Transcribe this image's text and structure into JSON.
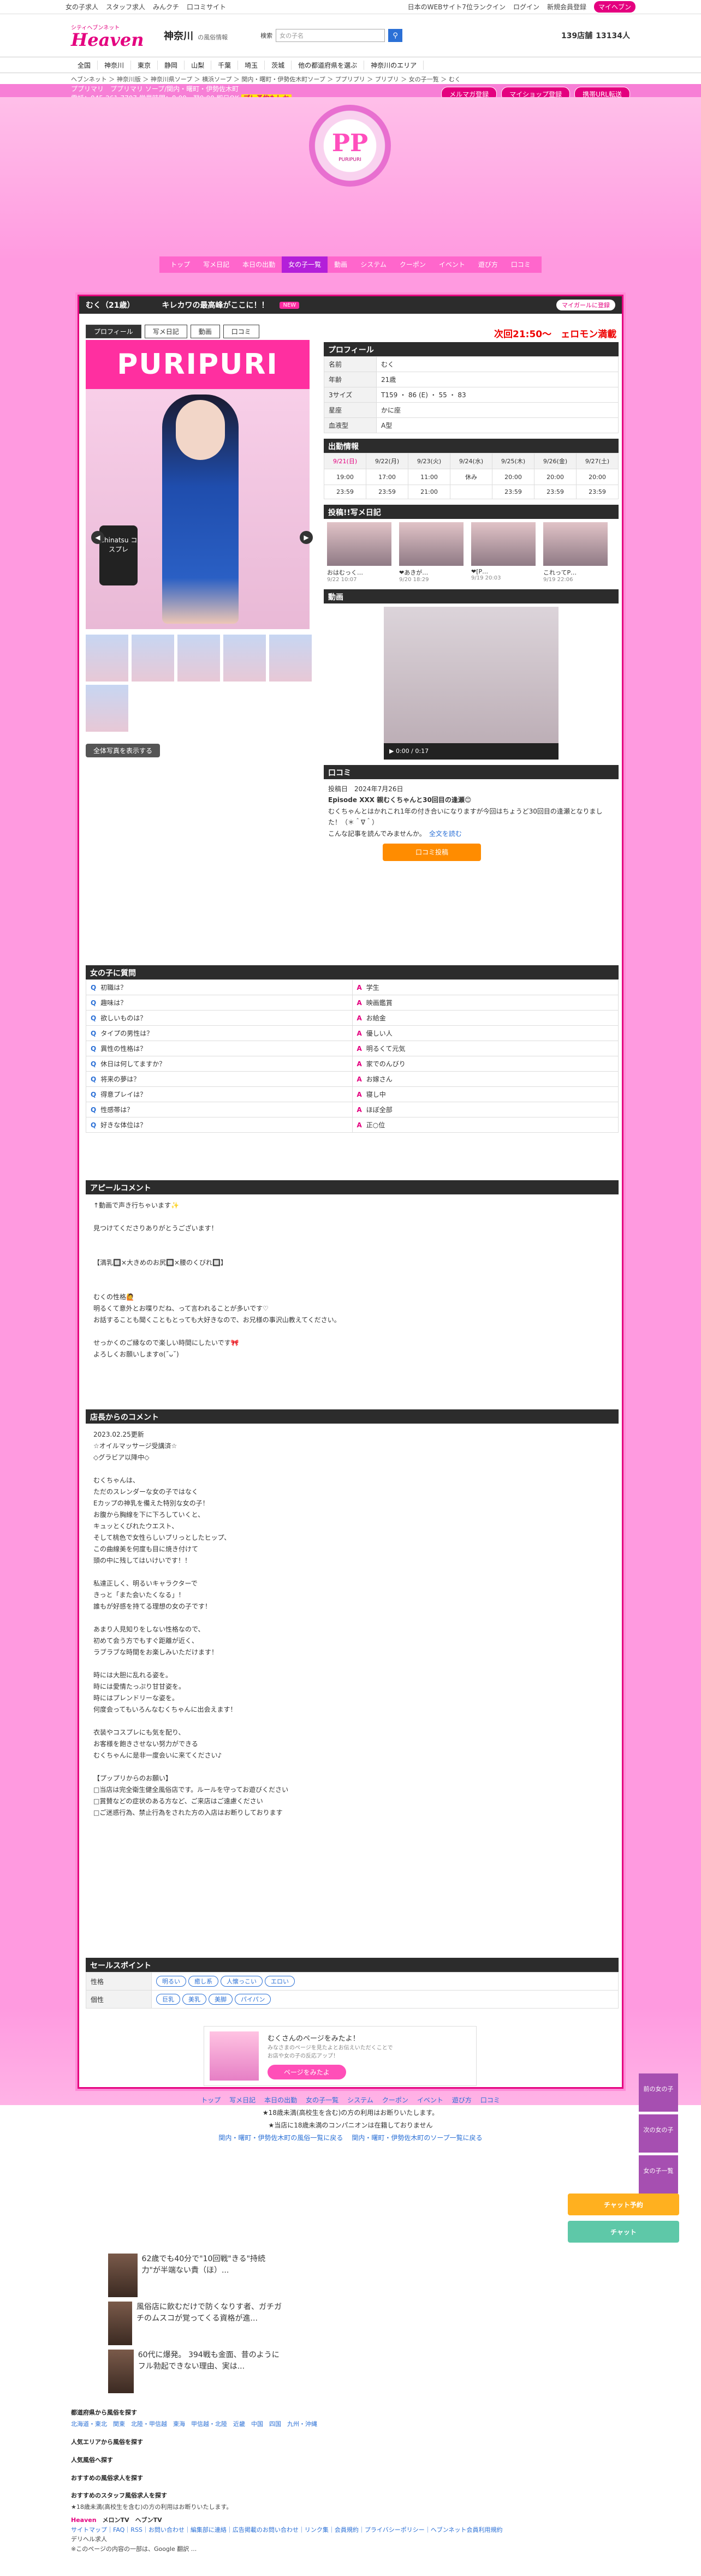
{
  "topbar": {
    "items": [
      "女の子求人",
      "スタッフ求人",
      "みんクチ",
      "口コミサイト"
    ],
    "right": [
      "日本のWEBサイト7位ランクイン",
      "ログイン",
      "新規会員登録",
      "マイヘブン"
    ]
  },
  "header": {
    "brand": "Heaven",
    "brand_sub": "シティヘブンネット",
    "area": "神奈川",
    "area_sub": "の風俗情報",
    "search_label": "検索",
    "search_placeholder": "女の子名",
    "count1": "139店舗",
    "count2": "13134人"
  },
  "nav": [
    "全国",
    "神奈川",
    "東京",
    "静岡",
    "山梨",
    "千葉",
    "埼玉",
    "茨城",
    "他の都道府県を選ぶ",
    "神奈川のエリア"
  ],
  "breadcrumb": "ヘブンネット ＞ 神奈川版 ＞ 神奈川県ソープ ＞ 横浜ソープ ＞ 関内・曙町・伊勢佐木町ソープ ＞ ププリプリ ＞ プリプリ ＞ 女の子一覧 ＞ むく",
  "pinkband": {
    "line1": "ププリマリ　ププリマリ ソープ/関内・曙町・伊勢佐木町",
    "line2": "電話：045-261-7707 営業時間：8:00～翌0:00 即日OK",
    "highlight": "プレ予約もしか",
    "buttons": [
      "メルマガ登録",
      "マイショップ登録",
      "携帯URL転送"
    ]
  },
  "shop": {
    "logo": "PP",
    "logo_caption": "PURIPURI"
  },
  "shopnav": [
    "トップ",
    "写メ日記",
    "本日の出勤",
    "女の子一覧",
    "動画",
    "システム",
    "クーポン",
    "イベント",
    "遊び方",
    "口コミ"
  ],
  "girl": {
    "name": "むく（21歳）",
    "catch": "キレカワの最高峰がここに！！",
    "badge": "NEW",
    "fav": "マイガールに登録",
    "tabs": [
      "プロフィール",
      "写メ日記",
      "動画",
      "口コミ"
    ],
    "marquee": "次回21:50～　ェロモン満載　絶対",
    "brand_banner": "PURIPURI",
    "photo_badge": "Chinatsu コスプレ",
    "all_btn": "全体写真を表示する"
  },
  "profile": {
    "title": "プロフィール",
    "rows": [
      {
        "k": "名前",
        "v": "むく"
      },
      {
        "k": "年齢",
        "v": "21歳"
      },
      {
        "k": "3サイズ",
        "v": "T159 ・ 86 (E) ・ 55 ・ 83"
      },
      {
        "k": "星座",
        "v": "かに座"
      },
      {
        "k": "血液型",
        "v": "A型"
      }
    ]
  },
  "schedule": {
    "title": "出勤情報",
    "days": [
      "9/21(日)",
      "9/22(月)",
      "9/23(火)",
      "9/24(水)",
      "9/25(木)",
      "9/26(金)",
      "9/27(土)"
    ],
    "start": [
      "19:00",
      "17:00",
      "11:00",
      "休み",
      "20:00",
      "20:00",
      "20:00"
    ],
    "end": [
      "23:59",
      "23:59",
      "21:00",
      "",
      "23:59",
      "23:59",
      "23:59"
    ]
  },
  "diary": {
    "title": "投稿!!写メ日記",
    "items": [
      {
        "t": "おはむっく…",
        "d": "9/22 10:07"
      },
      {
        "t": "❤あきが…",
        "d": "9/20 18:29"
      },
      {
        "t": "❤[P…",
        "d": "9/19 20:03"
      },
      {
        "t": "これってP…",
        "d": "9/19 22:06"
      }
    ]
  },
  "movie": {
    "title": "動画",
    "time": "0:00 / 0:17"
  },
  "review": {
    "title": "口コミ",
    "date_label": "投稿日",
    "date": "2024年7月26日",
    "heading": "Episode XXX 親むくちゃんと30回目の逢瀬😊",
    "body": "むくちゃんとはかれこれ1年の付き合いになりますが今回はちょうど30回目の逢瀬となりました！（＊＾∇＾）",
    "helpful": "こんな記事を読んでみませんか。",
    "all": "全文を読む",
    "button": "口コミ投稿"
  },
  "qa": {
    "title": "女の子に質問",
    "rows": [
      {
        "q": "初職は？",
        "a": "学生"
      },
      {
        "q": "趣味は？",
        "a": "映画鑑賞"
      },
      {
        "q": "欲しいものは？",
        "a": "お給金"
      },
      {
        "q": "タイプの男性は？",
        "a": "優しい人"
      },
      {
        "q": "異性の性格は？",
        "a": "明るくて元気"
      },
      {
        "q": "休日は何してますか？",
        "a": "家でのんびり"
      },
      {
        "q": "将来の夢は？",
        "a": "お嫁さん"
      },
      {
        "q": "得意プレイは？",
        "a": "寝し中"
      },
      {
        "q": "性感帯は？",
        "a": "ほぼ全部"
      },
      {
        "q": "好きな体位は？",
        "a": "正○位"
      }
    ]
  },
  "appeal": {
    "title": "アピールコメント",
    "body": "↑動画で声き行ちゃいます✨\n\n見つけてくださりありがとうございます！\n\n\n【満乳🔲×大きめのお尻🔲×腰のくびれ🔲】\n\n\nむくの性格🙋\n明るくて意外とお喋りだね、って言われることが多いです♡\nお話することも聞くこともとっても大好きなので、お兄様の事沢山教えてください。\n\nせっかくのご縁なので楽しい時間にしたいです🎀\nよろしくお願いしますɞ(˘ᴗ˘)"
  },
  "shopcomment": {
    "title": "店長からのコメント",
    "body": "2023.02.25更新\n☆オイルマッサージ受講済☆\n◇グラビア以降中◇\n\nむくちゃんは、\nただのスレンダーな女の子ではなく\nEカップの神乳を備えた特別な女の子！\nお腹から胸線を下に下ろしていくと、\nキュッとくびれたウエスト、\nそして桃色で女性らしいプリっとしたヒップ、\nこの曲線美を何度も目に焼き付けて\n頭の中に残してはいけいです！！\n\n私達正しく、明るいキャラクターで\nきっと「また会いたくなる」！\n誰もが好感を持てる理想の女の子です！\n\nあまり人見知りをしない性格なので、\n初めて会う方でもすぐ距離が近く、\nラブラブな時間をお楽しみいただけます！\n\n時には大胆に乱れる姿を。\n時には愛情たっぷり甘甘姿を。\n時にはプレンドリーな姿を。\n何度会ってもいろんなむくちゃんに出会えます！\n\n衣装やコスプレにも気を配り、\nお客様を飽きさせない努力ができる\nむくちゃんに是非一度会いに来てください♪\n\n【プップリからのお願い】\n□当店は完全衛生健全風俗店です。ルールを守ってお遊びください\n□賞賛などの症状のある方など、ご来店はご遠慮ください\n□ご迷惑行為、禁止行為をされた方の入店はお断りしております"
  },
  "sellpoint": {
    "title": "セールスポイント",
    "rows": [
      {
        "k": "性格",
        "chips": [
          "明るい",
          "癒し系",
          "人懐っこい",
          "エロい"
        ]
      },
      {
        "k": "個性",
        "chips": [
          "巨乳",
          "美乳",
          "美脚",
          "パイパン"
        ]
      }
    ]
  },
  "banner": {
    "text": "むくさんのページをみたよ！",
    "sub": "みなさまのページを見たよとお伝えいただくことで\nお店や女の子の反応アップ！",
    "btn": "ページをみたよ"
  },
  "footnav": {
    "row1": [
      "トップ",
      "写メ日記",
      "本日の出勤",
      "女の子一覧",
      "システム",
      "クーポン",
      "イベント",
      "遊び方",
      "口コミ"
    ],
    "note1": "★18歳未満(高校生を含む)の方の利用はお断りいたします。",
    "note2": "★当店に18歳未満のコンパニオンは在籍しておりません",
    "back": [
      "関内・曙町・伊勢佐木町の風俗一覧に戻る",
      "関内・曙町・伊勢佐木町のソープ一覧に戻る"
    ]
  },
  "side": {
    "prev": "前の女の子",
    "next": "次の女の子",
    "list": "女の子一覧",
    "chat1": "チャット予約",
    "chat2": "チャット"
  },
  "articles": [
    {
      "t": "62歳でも40分で\"10回戦\"きる\"持続力\"が半端ない貴（ほ）..."
    },
    {
      "t": "風俗店に飲むだけで防くなりす者、ガチガチのムスコが覚ってくる資格が進..."
    },
    {
      "t": "60代に爆発。 394戦も金面、昔のようにフル勃起できない理由、実は..."
    }
  ],
  "links": {
    "h1": "都道府県から風俗を探す",
    "regions": [
      "北海道・東北",
      "関東",
      "北陸・甲信越",
      "東海",
      "甲信越・北陸",
      "近畿",
      "中国",
      "四国",
      "九州・沖縄"
    ],
    "h2": "人気エリアから風俗を探す",
    "h3": "人気風俗へ探す",
    "h4": "おすすめの風俗求人を探す",
    "h5": "おすすめのスタッフ風俗求人を探す",
    "note": "★18歳未満(高校生を含む)の方の利用はお断りいたします。"
  },
  "foot": {
    "brands": [
      "Heaven",
      "メロンTV",
      "ヘブンTV"
    ],
    "links": "サイトマップ｜FAQ｜RSS｜お問い合わせ｜編集部に連絡｜広告掲載のお問い合わせ｜リンク集｜会員規約｜プライバシーポリシー｜ヘブンネット会員利用規約",
    "copy": "※このページの内容の一部は、Google 翻訳 ...",
    "terms": "デリヘル求人"
  }
}
